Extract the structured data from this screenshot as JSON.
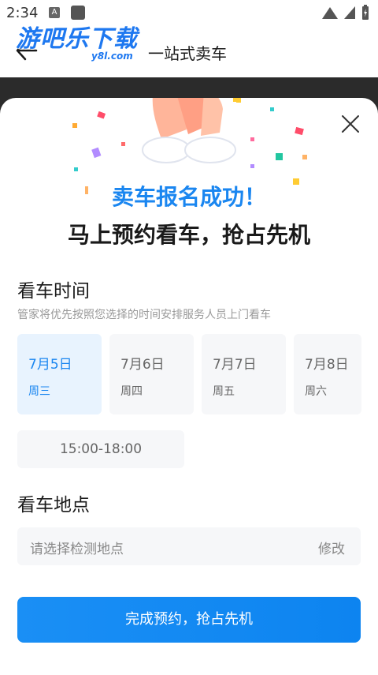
{
  "status_bar": {
    "time": "2:34",
    "notification_letter": "A"
  },
  "watermark": {
    "text": "游吧乐下载",
    "sub": "y8l.com"
  },
  "nav": {
    "title": "一站式卖车"
  },
  "success": {
    "headline": "卖车报名成功！",
    "subheadline": "马上预约看车，抢占先机"
  },
  "viewing_time": {
    "title": "看车时间",
    "description": "管家将优先按照您选择的时间安排服务人员上门看车",
    "dates": [
      {
        "date": "7月5日",
        "weekday": "周三",
        "selected": true
      },
      {
        "date": "7月6日",
        "weekday": "周四",
        "selected": false
      },
      {
        "date": "7月7日",
        "weekday": "周五",
        "selected": false
      },
      {
        "date": "7月8日",
        "weekday": "周六",
        "selected": false
      }
    ],
    "time_slot": "15:00-18:00"
  },
  "viewing_location": {
    "title": "看车地点",
    "placeholder": "请选择检测地点",
    "edit_label": "修改"
  },
  "submit_label": "完成预约，抢占先机",
  "colors": {
    "accent": "#1a86f0",
    "card_bg": "#f6f7f9",
    "selected_bg": "#e8f3fe"
  }
}
